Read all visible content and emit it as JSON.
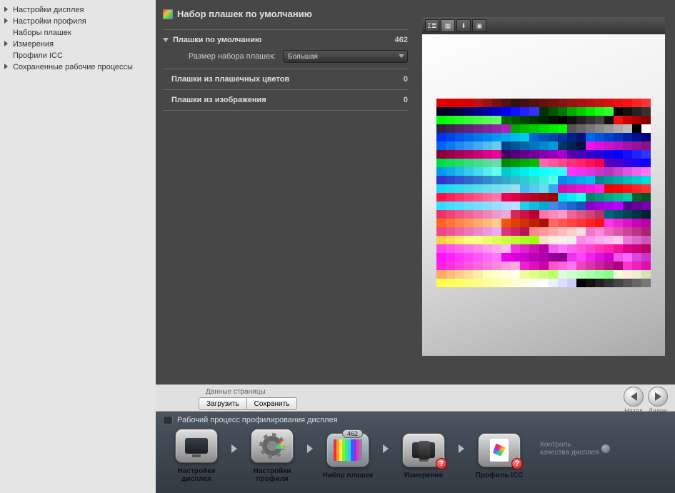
{
  "sidebar": {
    "items": [
      {
        "label": "Настройки дисплея",
        "expandable": true
      },
      {
        "label": "Настройки профиля",
        "expandable": true
      },
      {
        "label": "Наборы плашек",
        "expandable": false
      },
      {
        "label": "Измерения",
        "expandable": true
      },
      {
        "label": "Профили ICC",
        "expandable": false
      },
      {
        "label": "Сохраненные рабочие процессы",
        "expandable": true
      }
    ]
  },
  "panel": {
    "title": "Набор плашек по умолчанию",
    "sections": [
      {
        "label": "Плашки по умолчанию",
        "value": "462",
        "expanded": true
      },
      {
        "label": "Плашки из плашечных цветов",
        "value": "0",
        "expanded": false
      },
      {
        "label": "Плашки из изображения",
        "value": "0",
        "expanded": false
      }
    ],
    "sizeRow": {
      "label": "Размер набора плашек:",
      "value": "Большая"
    }
  },
  "toolbar": {
    "buttons": [
      "Σ≣",
      "▦",
      "⬇",
      "▣"
    ]
  },
  "fileBar": {
    "groupLabel": "Данные страницы",
    "load": "Загрузить",
    "save": "Сохранить"
  },
  "nav": {
    "back": "Назад",
    "next": "Далее"
  },
  "workflow": {
    "title": "Рабочий процесс профилирования дисплея",
    "steps": [
      {
        "label": "Настройки дисплея"
      },
      {
        "label": "Настройки профиля"
      },
      {
        "label": "Набор плашек",
        "active": true,
        "badge": "462"
      },
      {
        "label": "Измерение",
        "alert": true
      },
      {
        "label": "Профиль ICC",
        "alert": true
      }
    ],
    "qc": "Контроль\nкачества дисплея"
  },
  "patchColors": [
    [
      "#d00",
      "#d00",
      "#d00",
      "#d00",
      "#b11",
      "#911",
      "#711",
      "#511",
      "#311",
      "#411",
      "#511",
      "#611",
      "#711",
      "#811",
      "#911",
      "#a11",
      "#b11",
      "#c11",
      "#d11",
      "#e11",
      "#f11",
      "#f22",
      "#f33"
    ],
    [
      "#002",
      "#003",
      "#004",
      "#006",
      "#008",
      "#00a",
      "#00c",
      "#00e",
      "#11f",
      "#22f",
      "#33f",
      "#030",
      "#050",
      "#070",
      "#0a0",
      "#0c0",
      "#0e0",
      "#1f1",
      "#3f3",
      "#000",
      "#111",
      "#222",
      "#333"
    ],
    [
      "#0f0",
      "#1f1",
      "#2f2",
      "#3f3",
      "#4f4",
      "#5f5",
      "#6f6",
      "#060",
      "#050",
      "#040",
      "#030",
      "#020",
      "#010",
      "#000",
      "#111",
      "#222",
      "#333",
      "#444",
      "#111",
      "#e11",
      "#c00",
      "#a00",
      "#800"
    ],
    [
      "#324",
      "#425",
      "#526",
      "#627",
      "#728",
      "#829",
      "#92a",
      "#a2b",
      "#0a0",
      "#0b0",
      "#0c0",
      "#0d0",
      "#0e0",
      "#0f0",
      "#555",
      "#666",
      "#777",
      "#888",
      "#999",
      "#aaa",
      "#bbb",
      "#000",
      "#fff"
    ],
    [
      "#03e",
      "#04e",
      "#05e",
      "#06e",
      "#07e",
      "#08e",
      "#09e",
      "#0ae",
      "#0be",
      "#0ce",
      "#06c",
      "#05b",
      "#04a",
      "#039",
      "#028",
      "#017",
      "#06e",
      "#05d",
      "#04c",
      "#03b",
      "#02a",
      "#019",
      "#008"
    ],
    [
      "#06e",
      "#17e",
      "#28e",
      "#39e",
      "#4ae",
      "#5be",
      "#6ce",
      "#048",
      "#059",
      "#06a",
      "#07b",
      "#08c",
      "#09d",
      "#036",
      "#025",
      "#014",
      "#e1e",
      "#d1d",
      "#c1c",
      "#b1b",
      "#a1a",
      "#919",
      "#818"
    ],
    [
      "#803",
      "#904",
      "#a05",
      "#b06",
      "#c07",
      "#d08",
      "#e09",
      "#406",
      "#507",
      "#608",
      "#709",
      "#80a",
      "#90b",
      "#a0c",
      "#50a",
      "#40b",
      "#30c",
      "#20d",
      "#10e",
      "#00f",
      "#11f",
      "#22f",
      "#33f"
    ],
    [
      "#0d4",
      "#1d5",
      "#2d6",
      "#3d7",
      "#4d8",
      "#5d9",
      "#6da",
      "#080",
      "#090",
      "#0a0",
      "#0b0",
      "#f6a",
      "#f59",
      "#f48",
      "#f37",
      "#f26",
      "#f15",
      "#f04",
      "#50b",
      "#40c",
      "#30d",
      "#20e",
      "#10f"
    ],
    [
      "#09e",
      "#1ae",
      "#2be",
      "#3ce",
      "#4de",
      "#5ee",
      "#6fe",
      "#0cc",
      "#0dd",
      "#0ee",
      "#0ff",
      "#1ff",
      "#2ff",
      "#3ff",
      "#f3f",
      "#e3e",
      "#d3d",
      "#c3c",
      "#b3b",
      "#c4c",
      "#d5d",
      "#e6e",
      "#f7f"
    ],
    [
      "#33c",
      "#34c",
      "#35c",
      "#36c",
      "#37c",
      "#38c",
      "#39c",
      "#3ac",
      "#3bc",
      "#3cc",
      "#3dc",
      "#4ed",
      "#5fe",
      "#08e",
      "#09e",
      "#0ae",
      "#0be",
      "#088",
      "#099",
      "#0aa",
      "#0bb",
      "#0cc",
      "#0dd"
    ],
    [
      "#1de",
      "#2de",
      "#3de",
      "#4de",
      "#5de",
      "#6de",
      "#7de",
      "#8de",
      "#9de",
      "#4be",
      "#5ce",
      "#6de",
      "#3ae",
      "#c1a",
      "#d1b",
      "#e1c",
      "#f1d",
      "#f2e",
      "#e00",
      "#f00",
      "#f11",
      "#f22",
      "#f33"
    ],
    [
      "#f14",
      "#f25",
      "#f36",
      "#f47",
      "#f58",
      "#f69",
      "#f7a",
      "#e05",
      "#d04",
      "#c03",
      "#b02",
      "#a01",
      "#900",
      "#0de",
      "#1ee",
      "#2fe",
      "#086",
      "#097",
      "#0a8",
      "#0b9",
      "#0ca",
      "#063",
      "#052"
    ],
    [
      "#3df",
      "#4df",
      "#5df",
      "#6df",
      "#7df",
      "#8df",
      "#9df",
      "#adf",
      "#bdf",
      "#2ce",
      "#1bd",
      "#0ac",
      "#48e",
      "#37d",
      "#26c",
      "#15b",
      "#80c",
      "#90d",
      "#a0e",
      "#b0f",
      "#508",
      "#609",
      "#70a"
    ],
    [
      "#e36",
      "#e47",
      "#e58",
      "#e69",
      "#e7a",
      "#e8b",
      "#e9c",
      "#ead",
      "#d25",
      "#c14",
      "#b03",
      "#f7a",
      "#f8b",
      "#f9c",
      "#e69",
      "#d58",
      "#c47",
      "#b36",
      "#067",
      "#056",
      "#045",
      "#034",
      "#023"
    ],
    [
      "#f62",
      "#f73",
      "#f84",
      "#f95",
      "#fa6",
      "#fb7",
      "#fc8",
      "#e51",
      "#d40",
      "#c30",
      "#b20",
      "#a10",
      "#f66",
      "#f55",
      "#f44",
      "#f33",
      "#f22",
      "#f11",
      "#f3e",
      "#e2d",
      "#d1c",
      "#c0b",
      "#b0a"
    ],
    [
      "#e48",
      "#e59",
      "#e6a",
      "#e7b",
      "#e8c",
      "#e9d",
      "#eae",
      "#d37",
      "#c26",
      "#b15",
      "#f88",
      "#f99",
      "#faa",
      "#fbb",
      "#fcc",
      "#fdd",
      "#e7c",
      "#f8d",
      "#e6b",
      "#d5a",
      "#c49",
      "#b38",
      "#a27"
    ],
    [
      "#fc4",
      "#fd5",
      "#fe6",
      "#ff7",
      "#ff8",
      "#ef6",
      "#df5",
      "#cf4",
      "#bf3",
      "#af2",
      "#9f1",
      "#fdc",
      "#fed",
      "#fee",
      "#eee",
      "#f8e",
      "#f9e",
      "#fae",
      "#fbe",
      "#fce",
      "#e7d",
      "#d6c",
      "#c5b"
    ],
    [
      "#f4e",
      "#f5e",
      "#f6e",
      "#f7e",
      "#f8e",
      "#f9e",
      "#fae",
      "#fbe",
      "#e3d",
      "#d2c",
      "#c1b",
      "#b0a",
      "#e6e",
      "#f7f",
      "#f6e",
      "#f5d",
      "#f4c",
      "#f3b",
      "#f2a",
      "#e19",
      "#d08",
      "#c07",
      "#b06"
    ],
    [
      "#f1f",
      "#f2f",
      "#f3f",
      "#f4f",
      "#f5f",
      "#f6f",
      "#f7f",
      "#e0e",
      "#d0d",
      "#c0c",
      "#b0b",
      "#a0a",
      "#909",
      "#808",
      "#e3e",
      "#f4f",
      "#e2e",
      "#d1d",
      "#c0c",
      "#e5e",
      "#f6f",
      "#d4d",
      "#c3c"
    ],
    [
      "#f2d",
      "#f3d",
      "#f4d",
      "#f5d",
      "#f6d",
      "#f7d",
      "#f8d",
      "#f9d",
      "#fad",
      "#e2c",
      "#d1b",
      "#c0a",
      "#f5c",
      "#f6d",
      "#f7e",
      "#e4b",
      "#d3a",
      "#c29",
      "#b18",
      "#a07",
      "#f3c",
      "#e2b",
      "#d1a"
    ],
    [
      "#fa6",
      "#fb7",
      "#fc8",
      "#fd9",
      "#fea",
      "#ffb",
      "#ffc",
      "#ffd",
      "#ffe",
      "#ef9",
      "#df8",
      "#cf7",
      "#bf6",
      "#dfd",
      "#cfc",
      "#bfb",
      "#afa",
      "#9f9",
      "#8f8",
      "#efd",
      "#fed",
      "#eec",
      "#ddb"
    ],
    [
      "#ff4",
      "#ff5",
      "#ff6",
      "#ff7",
      "#ff8",
      "#ff9",
      "#ffa",
      "#ffb",
      "#ffc",
      "#ffd",
      "#ffe",
      "#fff",
      "#eef",
      "#ddf",
      "#ccf",
      "#000",
      "#111",
      "#222",
      "#333",
      "#444",
      "#555",
      "#666",
      "#777"
    ]
  ]
}
